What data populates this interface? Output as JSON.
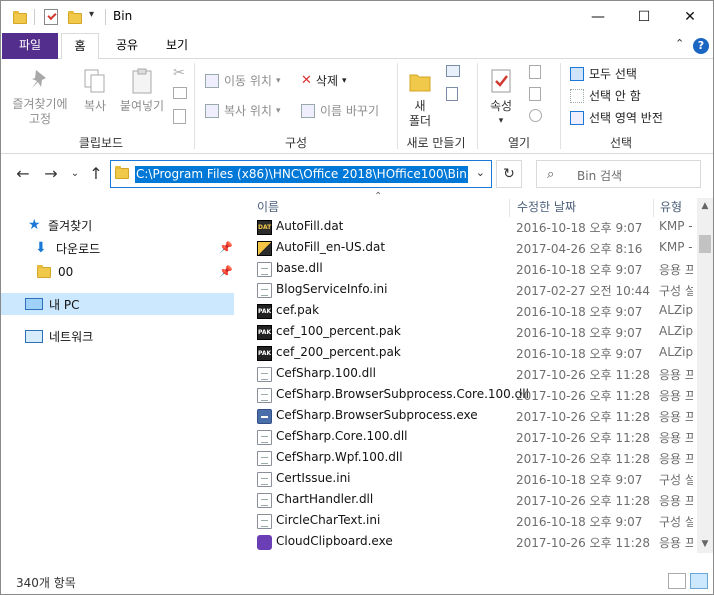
{
  "title": "Bin",
  "window_controls": {
    "minimize": "—",
    "maximize": "☐",
    "close": "✕"
  },
  "tabs": {
    "file": "파일",
    "home": "홈",
    "share": "공유",
    "view": "보기"
  },
  "ribbon": {
    "clipboard": {
      "pin": "즐겨찾기에\n고정",
      "copy": "복사",
      "paste": "붙여넣기",
      "label": "클립보드"
    },
    "organize": {
      "move": "이동 위치",
      "copy_to": "복사 위치",
      "delete": "삭제",
      "rename": "이름 바꾸기",
      "label": "구성"
    },
    "new": {
      "new_folder": "새\n폴더",
      "label": "새로 만들기"
    },
    "open": {
      "properties": "속성",
      "label": "열기"
    },
    "select": {
      "select_all": "모두 선택",
      "select_none": "선택 안 함",
      "invert": "선택 영역 반전",
      "label": "선택"
    }
  },
  "address": {
    "path": "C:\\Program Files (x86)\\HNC\\Office 2018\\HOffice100\\Bin"
  },
  "search": {
    "placeholder": "Bin 검색"
  },
  "nav": {
    "favorites": "즐겨찾기",
    "downloads": "다운로드",
    "folder00": "00",
    "thispc": "내 PC",
    "network": "네트워크"
  },
  "columns": {
    "name": "이름",
    "date": "수정한 날짜",
    "type": "유형"
  },
  "files": [
    {
      "name": "AutoFill.dat",
      "date": "2016-10-18 오후 9:07",
      "type": "KMP -",
      "icon": "dat-icon"
    },
    {
      "name": "AutoFill_en-US.dat",
      "date": "2017-04-26 오후 8:16",
      "type": "KMP -",
      "icon": "dat-icon"
    },
    {
      "name": "base.dll",
      "date": "2016-10-18 오후 9:07",
      "type": "응용 프",
      "icon": "dll-icon"
    },
    {
      "name": "BlogServiceInfo.ini",
      "date": "2017-02-27 오전 10:44",
      "type": "구성 설",
      "icon": "ini-icon"
    },
    {
      "name": "cef.pak",
      "date": "2016-10-18 오후 9:07",
      "type": "ALZip",
      "icon": "pak-icon"
    },
    {
      "name": "cef_100_percent.pak",
      "date": "2016-10-18 오후 9:07",
      "type": "ALZip",
      "icon": "pak-icon"
    },
    {
      "name": "cef_200_percent.pak",
      "date": "2016-10-18 오후 9:07",
      "type": "ALZip",
      "icon": "pak-icon"
    },
    {
      "name": "CefSharp.100.dll",
      "date": "2017-10-26 오후 11:28",
      "type": "응용 프",
      "icon": "dll-icon"
    },
    {
      "name": "CefSharp.BrowserSubprocess.Core.100.dll",
      "date": "2017-10-26 오후 11:28",
      "type": "응용 프",
      "icon": "dll-icon"
    },
    {
      "name": "CefSharp.BrowserSubprocess.exe",
      "date": "2017-10-26 오후 11:28",
      "type": "응용 프",
      "icon": "exe-icon"
    },
    {
      "name": "CefSharp.Core.100.dll",
      "date": "2017-10-26 오후 11:28",
      "type": "응용 프",
      "icon": "dll-icon"
    },
    {
      "name": "CefSharp.Wpf.100.dll",
      "date": "2017-10-26 오후 11:28",
      "type": "응용 프",
      "icon": "dll-icon"
    },
    {
      "name": "CertIssue.ini",
      "date": "2016-10-18 오후 9:07",
      "type": "구성 설",
      "icon": "ini-icon"
    },
    {
      "name": "ChartHandler.dll",
      "date": "2017-10-26 오후 11:28",
      "type": "응용 프",
      "icon": "dll-icon"
    },
    {
      "name": "CircleCharText.ini",
      "date": "2016-10-18 오후 9:07",
      "type": "구성 설",
      "icon": "ini-icon"
    },
    {
      "name": "CloudClipboard.exe",
      "date": "2017-10-26 오후 11:28",
      "type": "응용 프",
      "icon": "app-exe-icon"
    }
  ],
  "status": {
    "count": "340개 항목"
  }
}
